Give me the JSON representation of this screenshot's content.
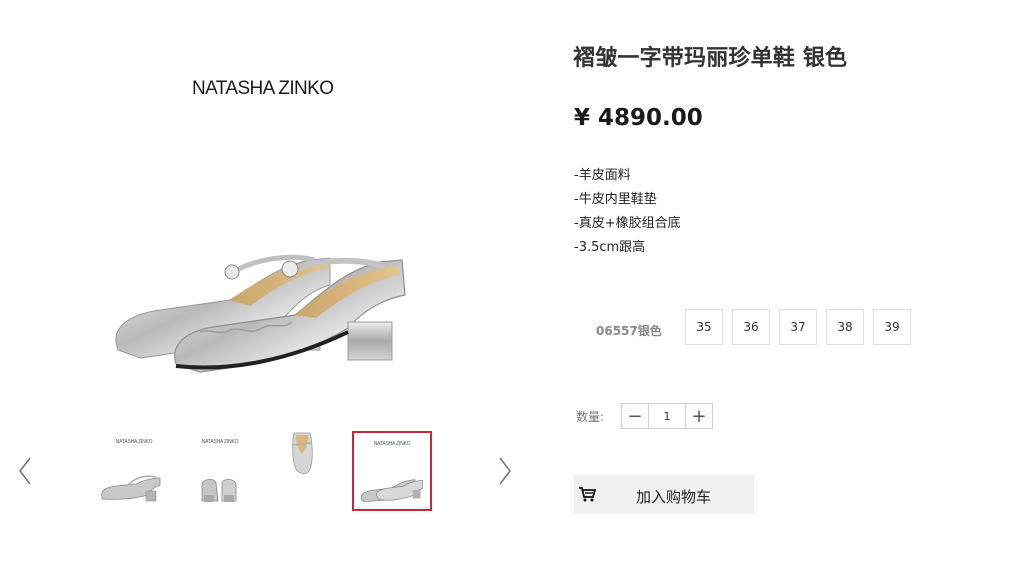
{
  "gallery": {
    "brand": "NATASHA ZINKO",
    "thumbnails": [
      {
        "logo": "NATASHA ZINKO",
        "selected": false
      },
      {
        "logo": "NATASHA ZINKO",
        "selected": false
      },
      {
        "logo": "",
        "selected": false
      },
      {
        "logo": "NATASHA ZINKO",
        "selected": true
      }
    ],
    "prev_icon": "chevron-left-icon",
    "next_icon": "chevron-right-icon"
  },
  "product": {
    "title": "褶皱一字带玛丽珍单鞋 银色",
    "price": "¥ 4890.00",
    "features": [
      "-羊皮面料",
      "-牛皮内里鞋垫",
      "-真皮+橡胶组合底",
      "-3.5cm跟高"
    ],
    "sku": "06557银色",
    "sizes": [
      "35",
      "36",
      "37",
      "38",
      "39"
    ]
  },
  "quantity": {
    "label": "数量:",
    "value": "1",
    "minus": "−",
    "plus": "+"
  },
  "cart": {
    "label": "加入购物车",
    "icon": "cart-icon"
  },
  "colors": {
    "selected_border": "#c8283a",
    "button_bg": "#f0f0f0"
  }
}
